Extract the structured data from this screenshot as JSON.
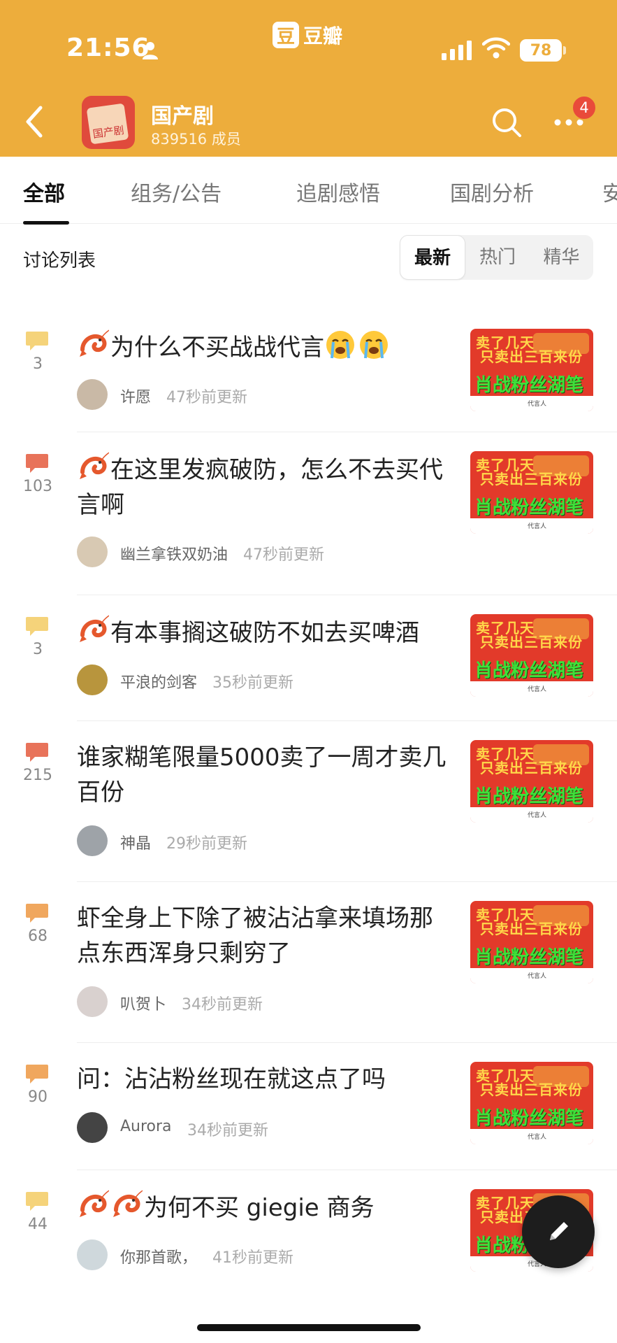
{
  "status_bar": {
    "time": "21:56",
    "app_name": "豆瓣",
    "app_mark": "豆",
    "battery": "78"
  },
  "group": {
    "name": "国产剧",
    "members": "839516 成员",
    "avatar_text": "国产剧",
    "notification_badge": "4"
  },
  "tabs": [
    "全部",
    "组务/公告",
    "追剧感悟",
    "国剧分析",
    "安"
  ],
  "list": {
    "title": "讨论列表",
    "sort_options": [
      "最新",
      "热门",
      "精华"
    ],
    "active_sort": "最新"
  },
  "thumbnail": {
    "line1": "卖了几天",
    "line2": "只卖出三百来份",
    "line3": "肖战粉丝湖笔",
    "caption": "代言人"
  },
  "posts": [
    {
      "comments": "3",
      "title": "为什么不买战战代言",
      "author": "许愿",
      "time": "47秒前更新",
      "icon_color": "#F5D37A"
    },
    {
      "comments": "103",
      "title": "在这里发疯破防，怎么不去买代言啊",
      "author": "幽兰拿铁双奶油",
      "time": "47秒前更新",
      "icon_color": "#E8735A"
    },
    {
      "comments": "3",
      "title": "有本事搁这破防不如去买啤酒",
      "author": "平浪的剑客",
      "time": "35秒前更新",
      "icon_color": "#F5D37A"
    },
    {
      "comments": "215",
      "title": "谁家糊笔限量5000卖了一周才卖几百份",
      "author": "神晶",
      "time": "29秒前更新",
      "icon_color": "#E8735A"
    },
    {
      "comments": "68",
      "title": "虾全身上下除了被沾沾拿来填场那点东西浑身只剩穷了",
      "author": "叭贺卜",
      "time": "34秒前更新",
      "icon_color": "#F0A75E"
    },
    {
      "comments": "90",
      "title": "问：沾沾粉丝现在就这点了吗",
      "author": "Aurora",
      "time": "34秒前更新",
      "icon_color": "#F0A75E"
    },
    {
      "comments": "44",
      "title": "为何不买 giegie 商务",
      "author": "你那首歌，",
      "time": "41秒前更新",
      "icon_color": "#F5D37A"
    }
  ]
}
